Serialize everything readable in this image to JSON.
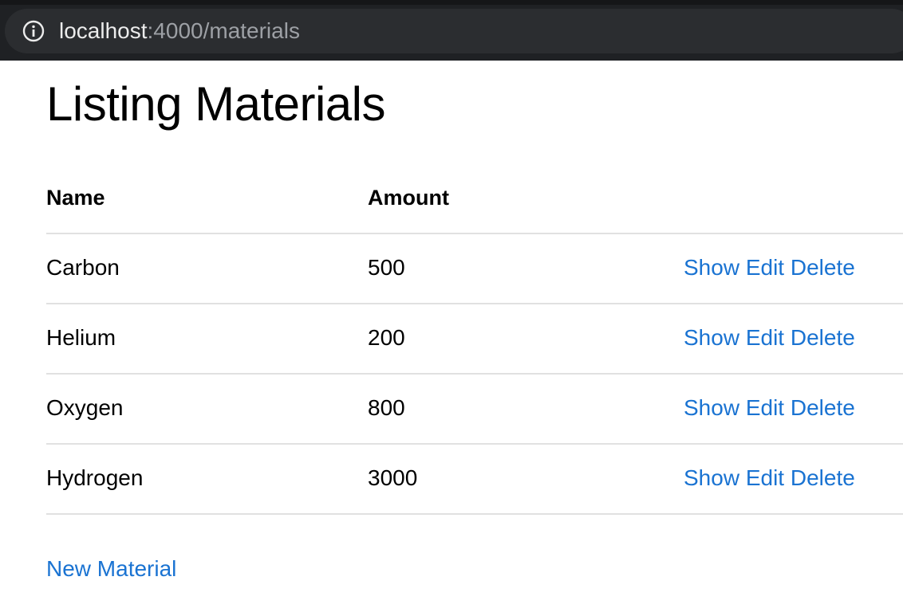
{
  "browser": {
    "url_host": "localhost",
    "url_rest": ":4000/materials",
    "info_icon": "info-circle-icon"
  },
  "page": {
    "title": "Listing Materials"
  },
  "table": {
    "headers": {
      "name": "Name",
      "amount": "Amount"
    },
    "rows": [
      {
        "name": "Carbon",
        "amount": "500",
        "show": "Show",
        "edit": "Edit",
        "delete": "Delete"
      },
      {
        "name": "Helium",
        "amount": "200",
        "show": "Show",
        "edit": "Edit",
        "delete": "Delete"
      },
      {
        "name": "Oxygen",
        "amount": "800",
        "show": "Show",
        "edit": "Edit",
        "delete": "Delete"
      },
      {
        "name": "Hydrogen",
        "amount": "3000",
        "show": "Show",
        "edit": "Edit",
        "delete": "Delete"
      }
    ]
  },
  "actions": {
    "new_material": "New Material"
  },
  "colors": {
    "link": "#1a73d2",
    "chrome_bg": "#1f2124",
    "address_bg": "#2b2d30",
    "divider": "#e1e1e1"
  }
}
